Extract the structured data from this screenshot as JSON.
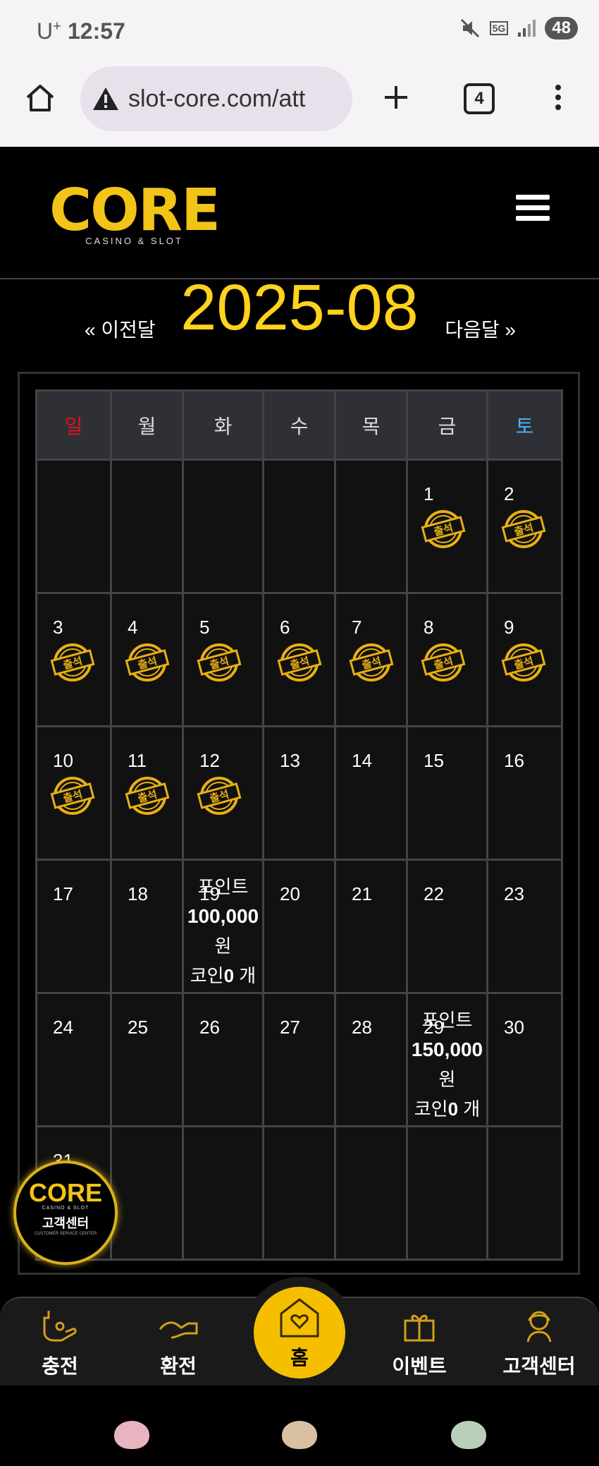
{
  "status_bar": {
    "carrier": "U",
    "carrier_sup": "+",
    "time": "12:57",
    "network": "5G",
    "battery": "48"
  },
  "browser": {
    "url": "slot-core.com/att",
    "tab_count": "4"
  },
  "header": {
    "logo": "CORE",
    "logo_sub": "CASINO & SLOT"
  },
  "month_nav": {
    "prev": "« 이전달",
    "month": "2025-08",
    "next": "다음달 »"
  },
  "weekdays": [
    "일",
    "월",
    "화",
    "수",
    "목",
    "금",
    "토"
  ],
  "weekday_colors": {
    "sun": "#e01020",
    "sat": "#4fb3ff",
    "other": "#dddddd"
  },
  "stamp_label": "출석",
  "calendar_weeks": [
    [
      {
        "day": ""
      },
      {
        "day": ""
      },
      {
        "day": ""
      },
      {
        "day": ""
      },
      {
        "day": ""
      },
      {
        "day": "1",
        "attended": true
      },
      {
        "day": "2",
        "attended": true
      }
    ],
    [
      {
        "day": "3",
        "attended": true
      },
      {
        "day": "4",
        "attended": true
      },
      {
        "day": "5",
        "attended": true
      },
      {
        "day": "6",
        "attended": true
      },
      {
        "day": "7",
        "attended": true
      },
      {
        "day": "8",
        "attended": true
      },
      {
        "day": "9",
        "attended": true
      }
    ],
    [
      {
        "day": "10",
        "attended": true
      },
      {
        "day": "11",
        "attended": true
      },
      {
        "day": "12",
        "attended": true
      },
      {
        "day": "13"
      },
      {
        "day": "14"
      },
      {
        "day": "15"
      },
      {
        "day": "16"
      }
    ],
    [
      {
        "day": "17"
      },
      {
        "day": "18"
      },
      {
        "day": "19",
        "reward": {
          "line1": "포인트",
          "amount": "100,000",
          "unit": "원",
          "coin_pre": "코인",
          "coin_val": "0",
          "coin_post": " 개"
        }
      },
      {
        "day": "20"
      },
      {
        "day": "21"
      },
      {
        "day": "22"
      },
      {
        "day": "23"
      }
    ],
    [
      {
        "day": "24"
      },
      {
        "day": "25"
      },
      {
        "day": "26"
      },
      {
        "day": "27"
      },
      {
        "day": "28"
      },
      {
        "day": "29",
        "reward": {
          "line1": "포인트",
          "amount": "150,000",
          "unit": "원",
          "coin_pre": "코인",
          "coin_val": "0",
          "coin_post": " 개"
        }
      },
      {
        "day": "30"
      }
    ],
    [
      {
        "day": "31"
      },
      {
        "day": ""
      },
      {
        "day": ""
      },
      {
        "day": ""
      },
      {
        "day": ""
      },
      {
        "day": ""
      },
      {
        "day": ""
      }
    ]
  ],
  "support_badge": {
    "logo": "CORE",
    "sub": "CASINO & SLOT",
    "title": "고객센터",
    "caption": "CUSTOMER SERVICE CENTER"
  },
  "bottom_nav": {
    "charge": "충전",
    "exchange": "환전",
    "home": "홈",
    "event": "이벤트",
    "support": "고객센터"
  },
  "accent_color": "#f5bf00",
  "frog_colors": [
    "#e8b4c0",
    "#d8c0a0",
    "#b8d0b8"
  ]
}
